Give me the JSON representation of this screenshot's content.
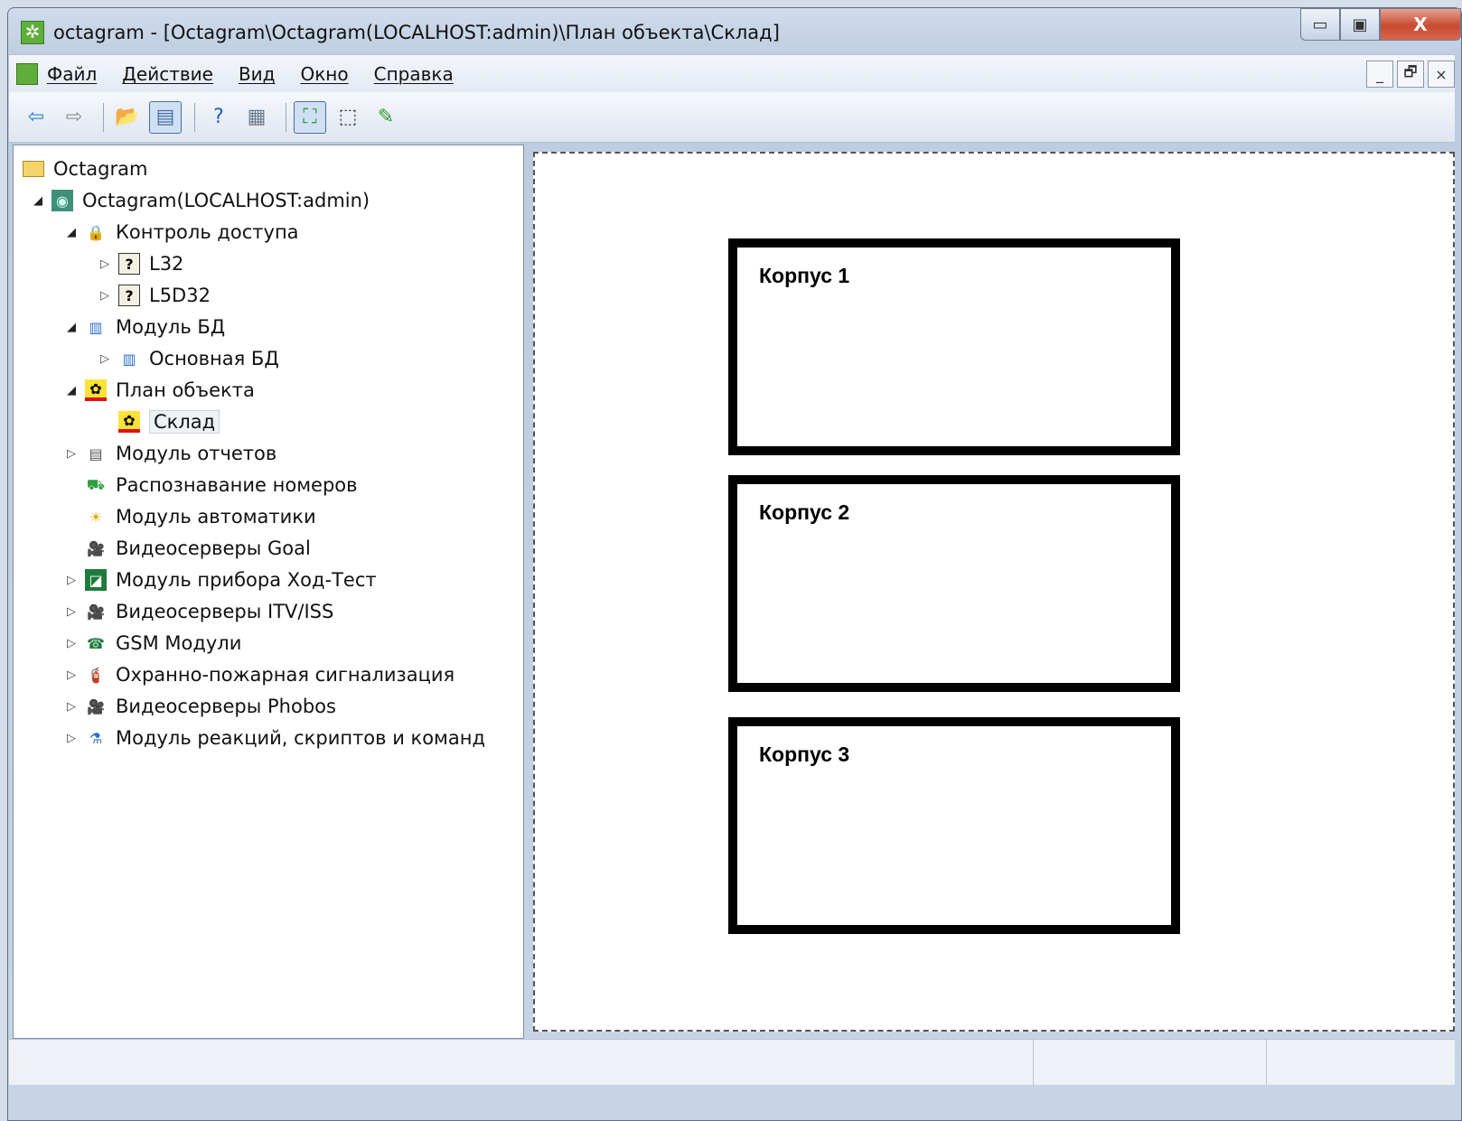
{
  "window": {
    "title": "octagram - [Octagram\\Octagram(LOCALHOST:admin)\\План объекта\\Склад]",
    "minimize_glyph": "▭",
    "maximize_glyph": "▣",
    "close_glyph": "X"
  },
  "menubar": {
    "items": [
      "Файл",
      "Действие",
      "Вид",
      "Окно",
      "Справка"
    ],
    "mdi": [
      "_",
      "🗗",
      "×"
    ]
  },
  "toolbar": {
    "buttons": [
      {
        "name": "back-arrow-icon",
        "glyph": "⇦",
        "color": "#2f7bd3"
      },
      {
        "name": "forward-arrow-icon",
        "glyph": "⇨",
        "color": "#8a8f96"
      },
      {
        "name": "up-folder-icon",
        "glyph": "📂",
        "color": "#c99a2e"
      },
      {
        "name": "show-tree-icon",
        "glyph": "▤",
        "color": "#4a6f9c"
      },
      {
        "name": "help-icon",
        "glyph": "?",
        "color": "#1f5fbf"
      },
      {
        "name": "show-pane-icon",
        "glyph": "▦",
        "color": "#6b7a8c"
      },
      {
        "name": "select-mode-icon",
        "glyph": "⛶",
        "color": "#2f9a2f"
      },
      {
        "name": "rect-select-icon",
        "glyph": "⬚",
        "color": "#333333"
      },
      {
        "name": "edit-mode-icon",
        "glyph": "✎",
        "color": "#2f9a2f"
      }
    ]
  },
  "tree": [
    {
      "label": "Octagram",
      "depth": 0,
      "expander": "",
      "icon": "folder-icon",
      "glyph": "▭",
      "color": "#e6c04a"
    },
    {
      "label": "Octagram(LOCALHOST:admin)",
      "depth": 1,
      "expander": "◢",
      "icon": "server-icon",
      "glyph": "◉",
      "color": "#2f8f5a"
    },
    {
      "label": "Контроль доступа",
      "depth": 2,
      "expander": "◢",
      "icon": "lock-icon",
      "glyph": "🔒",
      "color": "#c0392b"
    },
    {
      "label": "L32",
      "depth": 3,
      "expander": "▷",
      "icon": "unknown-device-icon",
      "glyph": "?",
      "color": "#000000"
    },
    {
      "label": "L5D32",
      "depth": 3,
      "expander": "▷",
      "icon": "unknown-device-icon",
      "glyph": "?",
      "color": "#000000"
    },
    {
      "label": "Модуль БД",
      "depth": 2,
      "expander": "◢",
      "icon": "database-icon",
      "glyph": "▥",
      "color": "#2b6fc7"
    },
    {
      "label": "Основная БД",
      "depth": 3,
      "expander": "▷",
      "icon": "database-icon",
      "glyph": "▥",
      "color": "#2b6fc7"
    },
    {
      "label": "План объекта",
      "depth": 2,
      "expander": "◢",
      "icon": "plan-icon",
      "glyph": "✿",
      "color": "#d63384"
    },
    {
      "label": "Склад",
      "depth": 3,
      "expander": "",
      "icon": "plan-icon",
      "glyph": "✿",
      "color": "#d63384",
      "selected": true
    },
    {
      "label": "Модуль отчетов",
      "depth": 2,
      "expander": "▷",
      "icon": "report-icon",
      "glyph": "▤",
      "color": "#555555"
    },
    {
      "label": "Распознавание номеров",
      "depth": 2,
      "expander": "",
      "icon": "car-icon",
      "glyph": "⛟",
      "color": "#2e9e3e"
    },
    {
      "label": "Модуль автоматики",
      "depth": 2,
      "expander": "",
      "icon": "automation-icon",
      "glyph": "☀",
      "color": "#e0a800"
    },
    {
      "label": "Видеосерверы Goal",
      "depth": 2,
      "expander": "",
      "icon": "camera-icon",
      "glyph": "🎥",
      "color": "#444444"
    },
    {
      "label": "Модуль прибора Ход-Тест",
      "depth": 2,
      "expander": "▷",
      "icon": "device-icon",
      "glyph": "◪",
      "color": "#1e7b3c"
    },
    {
      "label": "Видеосерверы ITV/ISS",
      "depth": 2,
      "expander": "▷",
      "icon": "camera-icon",
      "glyph": "🎥",
      "color": "#444444"
    },
    {
      "label": "GSM Модули",
      "depth": 2,
      "expander": "▷",
      "icon": "phone-icon",
      "glyph": "☎",
      "color": "#1e7b3c"
    },
    {
      "label": "Охранно-пожарная сигнализация",
      "depth": 2,
      "expander": "▷",
      "icon": "fire-extinguisher-icon",
      "glyph": "🧯",
      "color": "#c0392b"
    },
    {
      "label": "Видеосерверы Phobos",
      "depth": 2,
      "expander": "▷",
      "icon": "camera-icon",
      "glyph": "🎥",
      "color": "#444444"
    },
    {
      "label": "Модуль реакций, скриптов и команд",
      "depth": 2,
      "expander": "▷",
      "icon": "script-icon",
      "glyph": "⚗",
      "color": "#2b6fc7"
    }
  ],
  "plan": {
    "buildings": [
      {
        "label": "Корпус  1"
      },
      {
        "label": "Корпус 2"
      },
      {
        "label": "Корпус 3"
      }
    ]
  }
}
